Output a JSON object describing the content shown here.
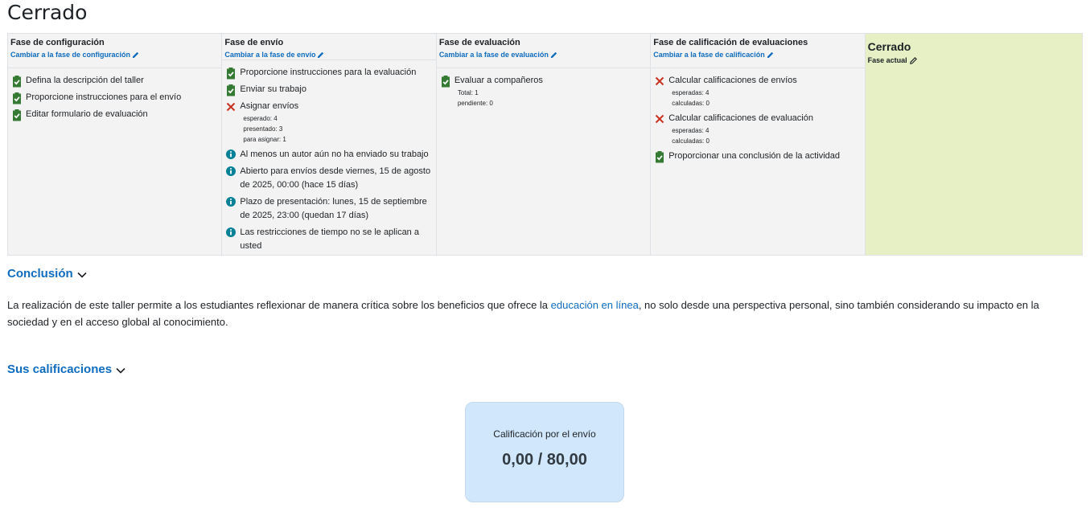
{
  "page": {
    "title": "Cerrado"
  },
  "phases": [
    {
      "title": "Fase de configuración",
      "link": "Cambiar a la fase de configuración",
      "tasks": [
        {
          "status": "done",
          "text": "Defina la descripción del taller",
          "details": []
        },
        {
          "status": "done",
          "text": "Proporcione instrucciones para el envío",
          "details": []
        },
        {
          "status": "done",
          "text": "Editar formulario de evaluación",
          "details": []
        }
      ]
    },
    {
      "title": "Fase de envío",
      "link": "Cambiar a la fase de envío",
      "tasks": [
        {
          "status": "done",
          "text": "Proporcione instrucciones para la evaluación",
          "details": []
        },
        {
          "status": "done",
          "text": "Enviar su trabajo",
          "details": []
        },
        {
          "status": "fail",
          "text": "Asignar envíos",
          "details": [
            "esperado: 4",
            "presentado: 3",
            "para asignar: 1"
          ]
        },
        {
          "status": "info",
          "text": "Al menos un autor aún no ha enviado su trabajo",
          "details": []
        },
        {
          "status": "info",
          "text": "Abierto para envíos desde viernes, 15 de agosto de 2025, 00:00 (hace 15 días)",
          "details": []
        },
        {
          "status": "info",
          "text": "Plazo de presentación: lunes, 15 de septiembre de 2025, 23:00 (quedan 17 días)",
          "details": []
        },
        {
          "status": "info",
          "text": "Las restricciones de tiempo no se le aplican a usted",
          "details": []
        }
      ]
    },
    {
      "title": "Fase de evaluación",
      "link": "Cambiar a la fase de evaluación",
      "tasks": [
        {
          "status": "done",
          "text": "Evaluar a compañeros",
          "details": [
            "Total: 1",
            "pendiente: 0"
          ]
        }
      ]
    },
    {
      "title": "Fase de calificación de evaluaciones",
      "link": "Cambiar a la fase de calificación",
      "tasks": [
        {
          "status": "fail",
          "text": "Calcular calificaciones de envíos",
          "details": [
            "esperadas: 4",
            "calculadas: 0"
          ]
        },
        {
          "status": "fail",
          "text": "Calcular calificaciones de evaluación",
          "details": [
            "esperadas: 4",
            "calculadas: 0"
          ]
        },
        {
          "status": "done",
          "text": "Proporcionar una conclusión de la actividad",
          "details": []
        }
      ]
    },
    {
      "title": "Cerrado",
      "current_label": "Fase actual",
      "tasks": []
    }
  ],
  "conclusion": {
    "heading": "Conclusión",
    "text_before": "La realización de este taller permite a los estudiantes reflexionar de manera crítica sobre los beneficios que ofrece la ",
    "link_text": "educación en línea",
    "text_after": ", no solo desde una perspectiva personal, sino también considerando su impacto en la sociedad y en el acceso global al conocimiento."
  },
  "grades": {
    "heading": "Sus calificaciones",
    "card_label": "Calificación por el envío",
    "card_value": "0,00 / 80,00"
  },
  "colors": {
    "done": "#357a32",
    "fail": "#ca3120",
    "info": "#008196",
    "link": "#0f6cbf",
    "active_phase": "#e6f0c4"
  }
}
